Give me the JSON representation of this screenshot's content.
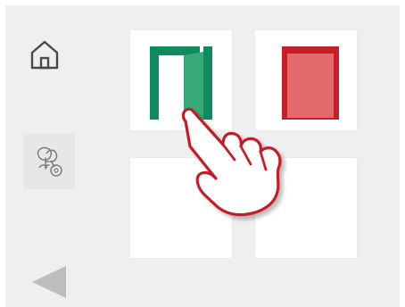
{
  "sidebar": {
    "items": [
      {
        "icon": "home-icon"
      },
      {
        "icon": "keys-icon"
      },
      {
        "icon": "back-arrow-icon"
      }
    ]
  },
  "tiles": [
    {
      "icon": "door-open-icon",
      "color": "#0f8b5e"
    },
    {
      "icon": "door-closed-icon",
      "color": "#c61f2a"
    },
    {
      "icon": ""
    },
    {
      "icon": ""
    }
  ],
  "overlay": {
    "icon": "tap-hand-icon"
  },
  "colors": {
    "background": "#efefef",
    "tile": "#ffffff",
    "accent_green": "#0f8b5e",
    "accent_red": "#c61f2a",
    "hand_outline": "#c61f2a"
  }
}
